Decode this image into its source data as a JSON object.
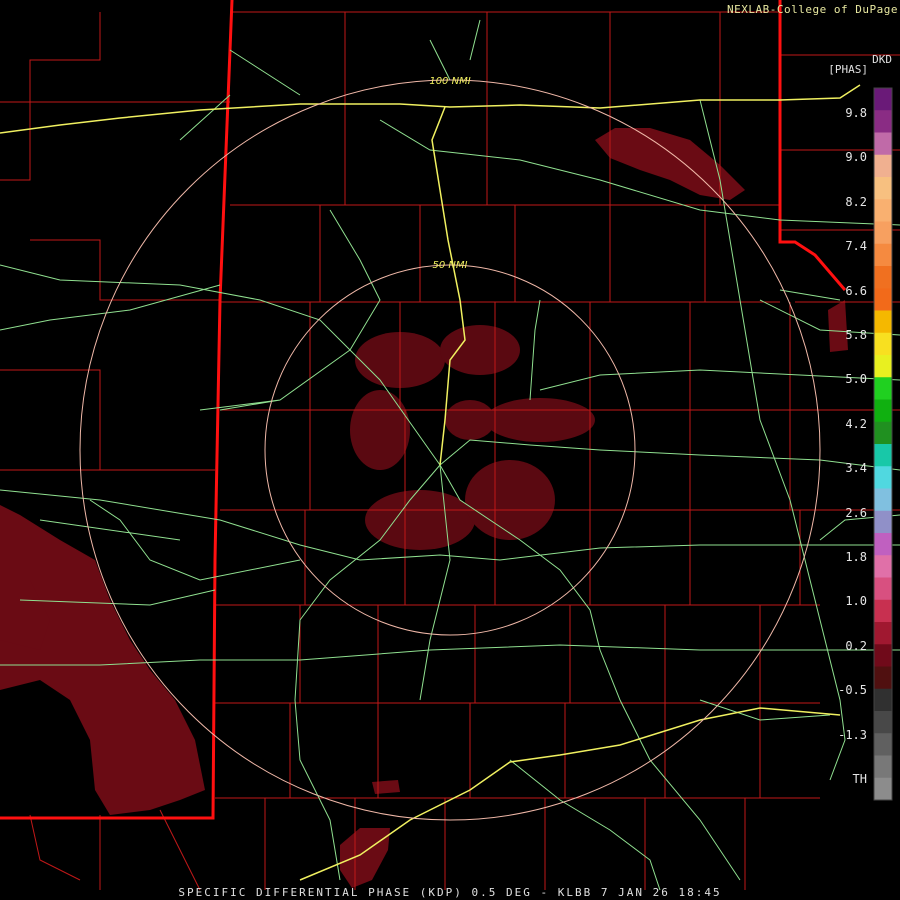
{
  "credit": "NEXLAB-College of DuPage",
  "product_code": "DKD",
  "unit": "[PHAS]",
  "caption": "SPECIFIC DIFFERENTIAL PHASE (KDP) 0.5 DEG - KLBB 7 JAN 26 18:45",
  "range_rings": [
    {
      "label": "50 NMI"
    },
    {
      "label": "100 NMI"
    }
  ],
  "legend": {
    "ticks": [
      "9.8",
      "9.0",
      "8.2",
      "7.4",
      "6.6",
      "5.8",
      "5.0",
      "4.2",
      "3.4",
      "2.6",
      "1.8",
      "1.0",
      "0.2",
      "-0.5",
      "-1.3",
      "TH"
    ],
    "colors": [
      "#6a1a78",
      "#8a2c84",
      "#c06aa8",
      "#f0b090",
      "#f7c080",
      "#f9b070",
      "#f7a060",
      "#f58a40",
      "#f07020",
      "#f26a1a",
      "#f5b800",
      "#f8e020",
      "#e8f020",
      "#20d020",
      "#10b010",
      "#209020",
      "#18c8a8",
      "#50d8e0",
      "#80c0e0",
      "#9090c8",
      "#c060c0",
      "#e070a8",
      "#d85080",
      "#c83050",
      "#a01830",
      "#700a1a",
      "#501010",
      "#303030",
      "#484848",
      "#606060",
      "#787878",
      "#8c8c8c"
    ],
    "text_color": "#e6e6e6"
  },
  "colors": {
    "background": "#000000",
    "county_lines": "#c01818",
    "state_lines": "#ff1010",
    "roads_minor": "#90e090",
    "roads_major": "#f0f060",
    "rings": "#f0b8a8",
    "echo": "#6a0b14"
  }
}
